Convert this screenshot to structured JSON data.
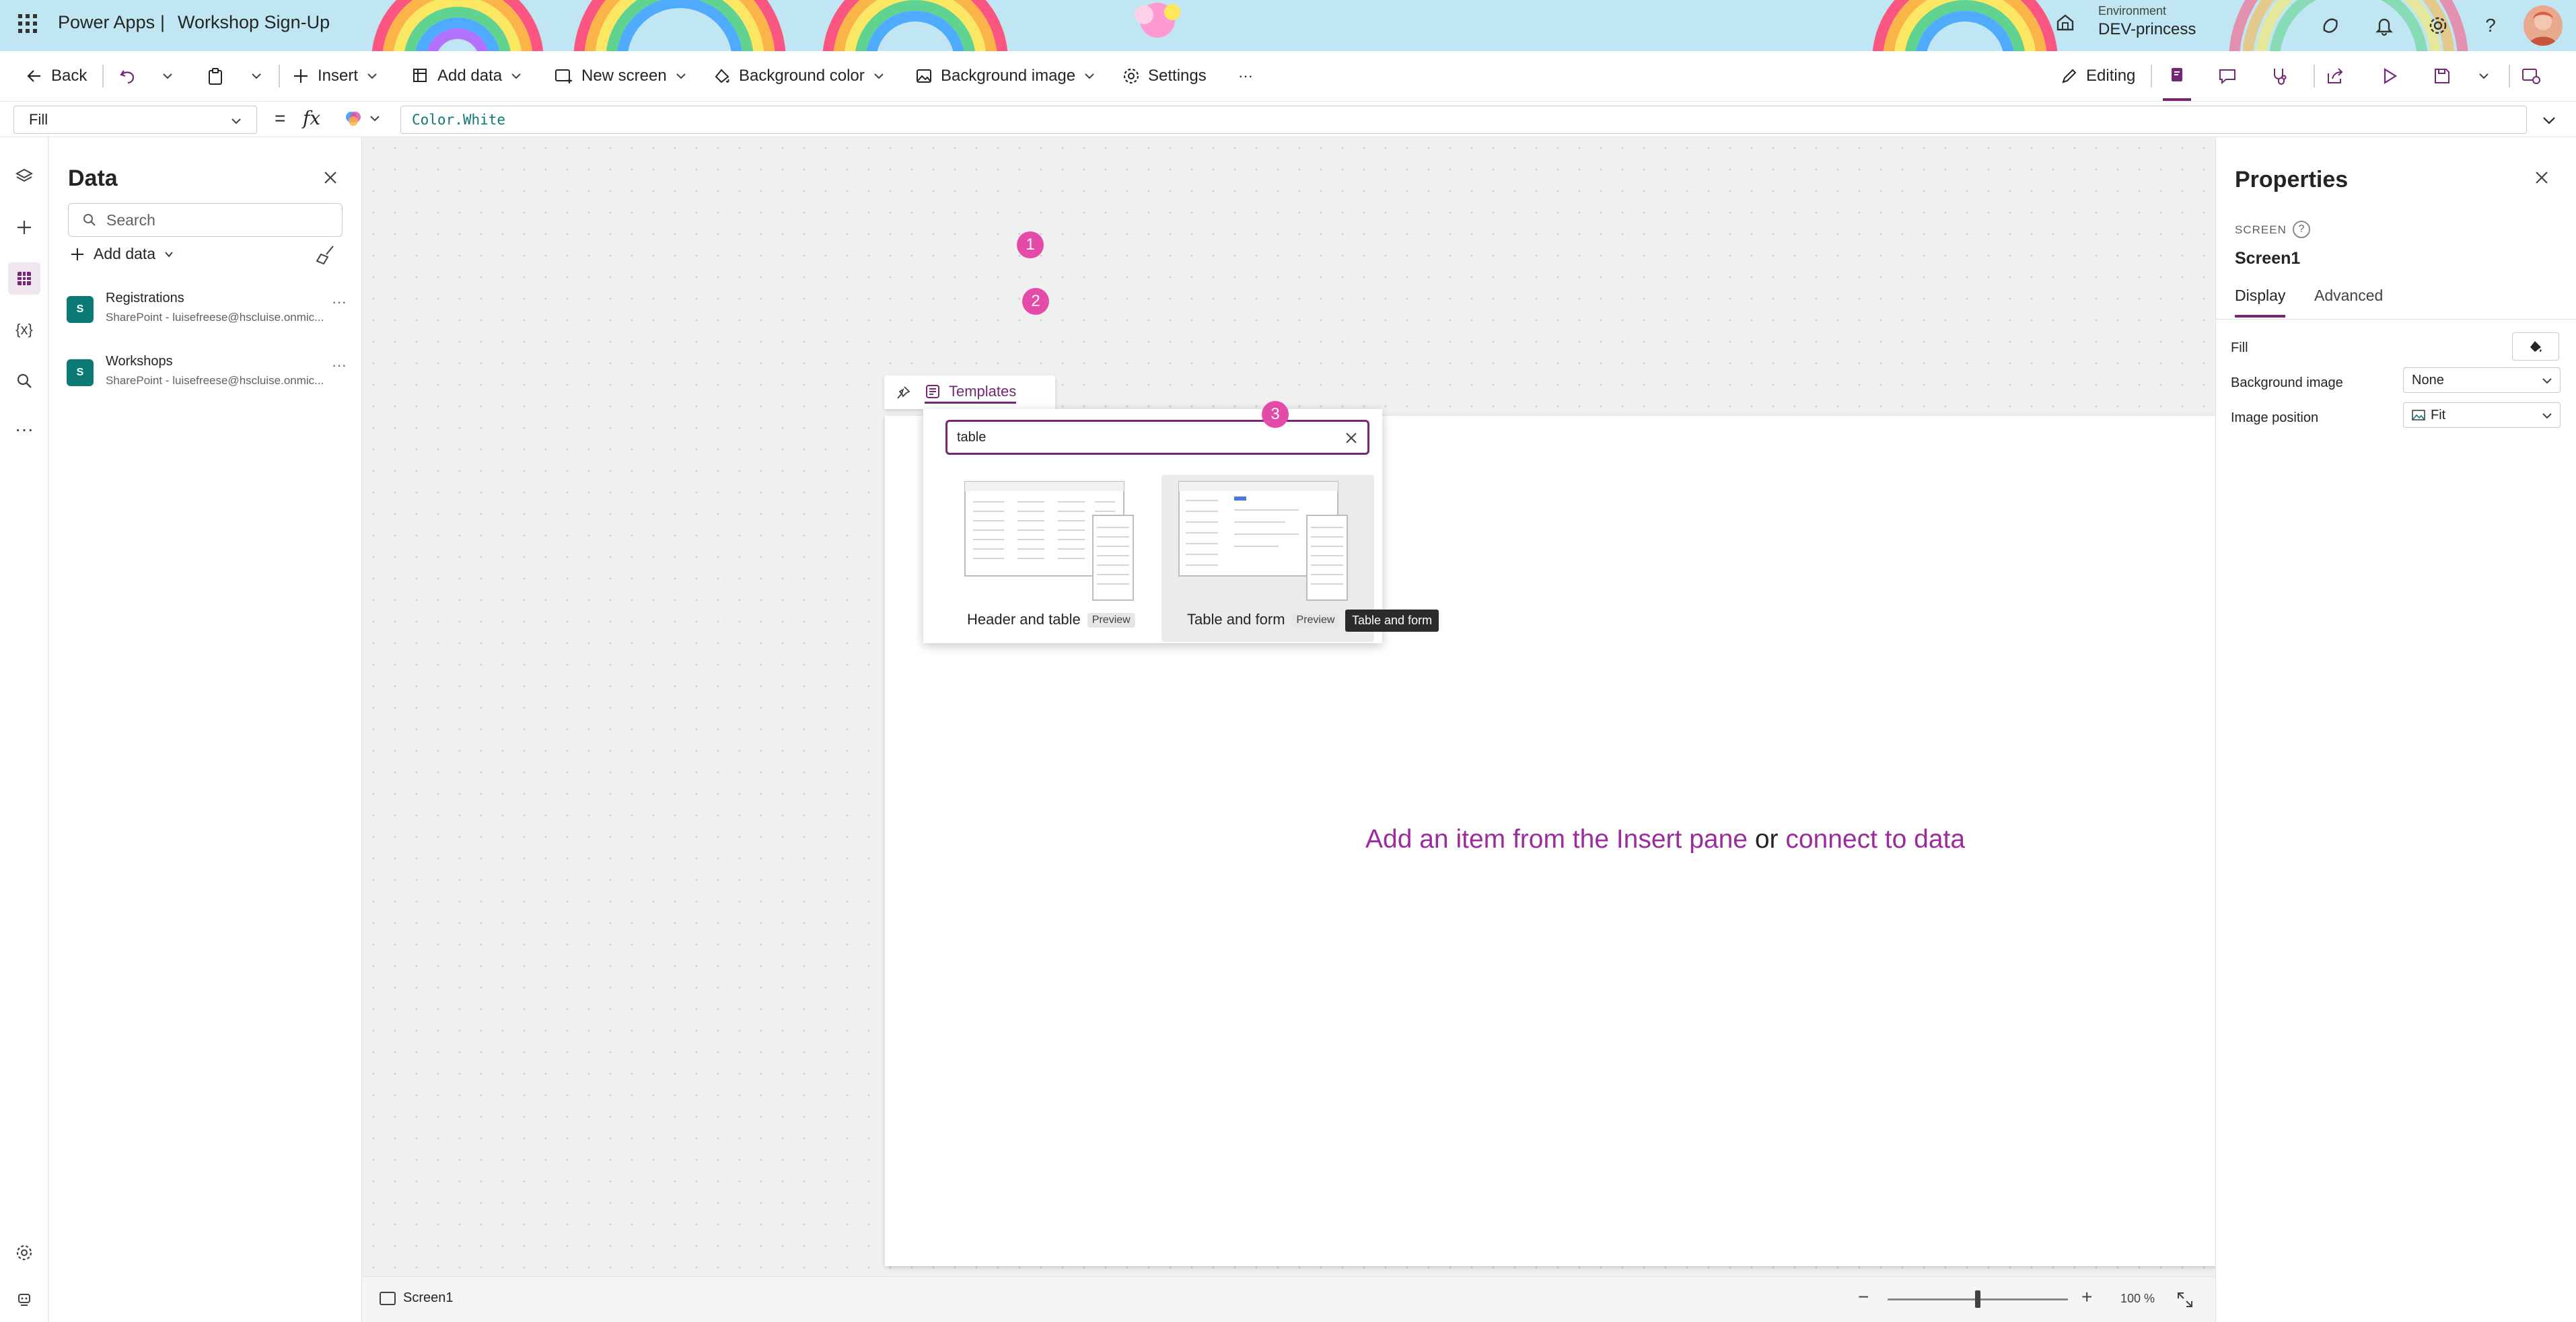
{
  "header": {
    "app_name": "Power Apps",
    "separator": "|",
    "app_title": "Workshop Sign-Up",
    "environment_label": "Environment",
    "environment_name": "DEV-princess"
  },
  "toolbar": {
    "back": "Back",
    "insert": "Insert",
    "add_data": "Add data",
    "new_screen": "New screen",
    "background_color": "Background color",
    "background_image": "Background image",
    "settings": "Settings",
    "more": "···",
    "editing": "Editing"
  },
  "formula_bar": {
    "property": "Fill",
    "equals": "=",
    "fx": "fx",
    "formula": "Color.White"
  },
  "data_panel": {
    "title": "Data",
    "search_placeholder": "Search",
    "add_data": "Add data",
    "sources": [
      {
        "name": "Registrations",
        "subtitle": "SharePoint - luisefreese@hscluise.onmic..."
      },
      {
        "name": "Workshops",
        "subtitle": "SharePoint - luisefreese@hscluise.onmic..."
      }
    ]
  },
  "templates_popup": {
    "tab_label": "Templates",
    "search_value": "table",
    "items": [
      {
        "label": "Header and table",
        "badge": "Preview"
      },
      {
        "label": "Table and form",
        "badge": "Preview"
      }
    ],
    "tooltip": "Table and form",
    "step_badges": [
      "1",
      "2",
      "3"
    ]
  },
  "canvas": {
    "hint_part1": "Add an item from the Insert pane",
    "hint_or": "or",
    "hint_link": "connect to data"
  },
  "status_bar": {
    "screen_name": "Screen1",
    "zoom_minus": "−",
    "zoom_plus": "+",
    "zoom_level": 100,
    "zoom_text": "100 %"
  },
  "properties_panel": {
    "title": "Properties",
    "type_label": "SCREEN",
    "screen_name": "Screen1",
    "tabs": [
      "Display",
      "Advanced"
    ],
    "fill_label": "Fill",
    "background_image_label": "Background image",
    "background_image_value": "None",
    "image_position_label": "Image position",
    "image_position_value": "Fit"
  },
  "colors": {
    "accent": "#742774",
    "badge": "#e44aa7",
    "link": "#9c2c9e",
    "sharepoint": "#0b7a75"
  }
}
